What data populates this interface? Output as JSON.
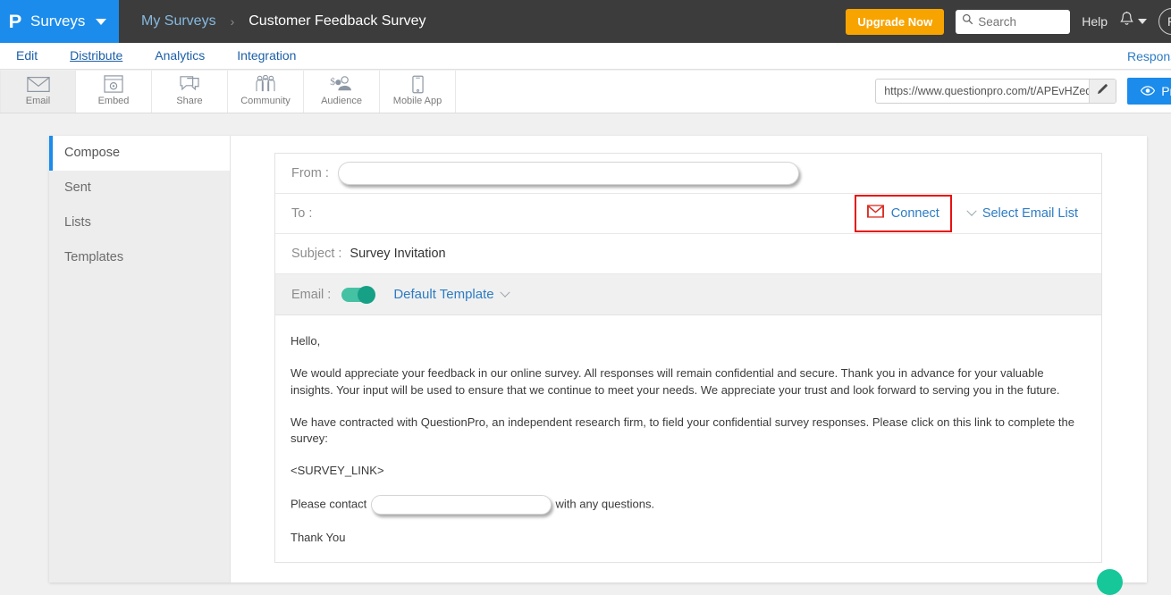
{
  "topbar": {
    "brand_logo": "P",
    "brand_text": "Surveys",
    "breadcrumb_parent": "My Surveys",
    "breadcrumb_sep": "›",
    "breadcrumb_current": "Customer Feedback Survey",
    "upgrade_label": "Upgrade Now",
    "search_placeholder": "Search",
    "help_label": "Help",
    "avatar_initial": "R"
  },
  "nav": {
    "tabs": [
      {
        "label": "Edit",
        "active": false
      },
      {
        "label": "Distribute",
        "active": true
      },
      {
        "label": "Analytics",
        "active": false
      },
      {
        "label": "Integration",
        "active": false
      }
    ],
    "right_link": "Responses"
  },
  "channels": {
    "items": [
      {
        "label": "Email",
        "icon": "envelope-icon",
        "active": true
      },
      {
        "label": "Embed",
        "icon": "embed-icon",
        "active": false
      },
      {
        "label": "Share",
        "icon": "share-icon",
        "active": false
      },
      {
        "label": "Community",
        "icon": "community-icon",
        "active": false
      },
      {
        "label": "Audience",
        "icon": "audience-icon",
        "active": false
      },
      {
        "label": "Mobile App",
        "icon": "mobile-icon",
        "active": false
      }
    ],
    "survey_url": "https://www.questionpro.com/t/APEvHZeq",
    "edit_icon": "pencil-icon",
    "preview_label": "Preview",
    "preview_icon": "eye-icon"
  },
  "sidebar": {
    "items": [
      {
        "label": "Compose",
        "active": true
      },
      {
        "label": "Sent",
        "active": false
      },
      {
        "label": "Lists",
        "active": false
      },
      {
        "label": "Templates",
        "active": false
      }
    ]
  },
  "compose": {
    "from_label": "From :",
    "from_value": "",
    "to_label": "To :",
    "connect_label": "Connect",
    "connect_icon": "gmail-icon",
    "select_list_label": "Select Email List",
    "subject_label": "Subject :",
    "subject_value": "Survey Invitation",
    "email_label": "Email :",
    "email_toggle_on": true,
    "template_label": "Default Template",
    "body": {
      "greeting": "Hello,",
      "paragraph1": "We would appreciate your feedback in our online survey.  All responses will remain confidential and secure.  Thank you in advance for your valuable insights.  Your input will be used to ensure that we continue to meet your needs. We appreciate your trust and look forward to serving you in the future.",
      "paragraph2": "We have contracted with QuestionPro, an independent research firm, to field your confidential survey responses.  Please click on this link to complete the survey:",
      "survey_link_token": "<SURVEY_LINK>",
      "contact_prefix": "Please contact",
      "contact_suffix": "with any questions.",
      "closing": "Thank You"
    }
  },
  "colors": {
    "brand_blue": "#1b8cec",
    "topbar_gray": "#3c3c3c",
    "upgrade_orange": "#f7a400",
    "link_blue": "#2c7cc4",
    "highlight_red": "#e81010",
    "toggle_green": "#16a085",
    "fab_teal": "#16c79a"
  }
}
